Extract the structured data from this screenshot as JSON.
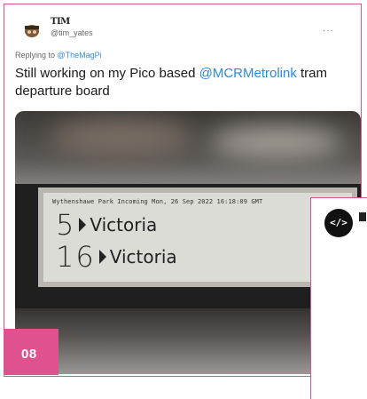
{
  "tweet": {
    "display_name": "TIM",
    "handle": "@tim_yates",
    "more_menu": "···",
    "reply_prefix": "Replying to ",
    "reply_mention": "@TheMagPi",
    "text_before": "Still working on my Pico based ",
    "text_mention": "@MCRMetrolink",
    "text_after": " tram departure board"
  },
  "board": {
    "header": "Wythenshawe Park Incoming Mon, 26 Sep 2022 16:18:09 GMT",
    "rows": [
      {
        "mins": "5",
        "destination": "Victoria"
      },
      {
        "mins": "16",
        "destination": "Victoria"
      }
    ]
  },
  "badge": {
    "number": "08"
  },
  "second_card": {
    "icon": "</>"
  },
  "colors": {
    "accent": "#e0528f",
    "link": "#2b8ae0"
  }
}
